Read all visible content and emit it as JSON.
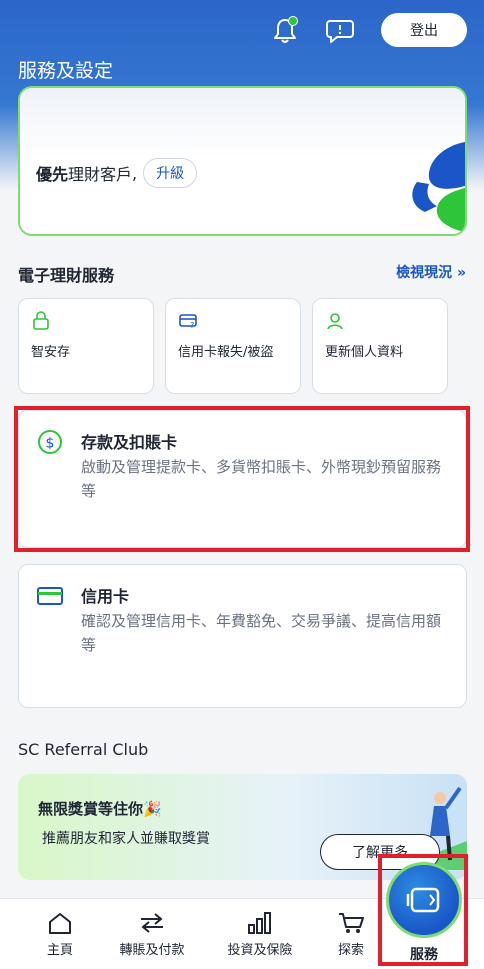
{
  "header": {
    "logout_label": "登出",
    "page_title": "服務及設定"
  },
  "profile": {
    "tier_bold": "優先",
    "tier_rest": "理財客戶",
    "separator": ",",
    "upgrade_label": "升級"
  },
  "ebanking": {
    "title": "電子理財服務",
    "view_link": "檢視現況 »",
    "tiles": [
      {
        "label": "智安存",
        "icon": "lock-icon"
      },
      {
        "label": "信用卡報失/被盜",
        "icon": "card-report-icon"
      },
      {
        "label": "更新個人資料",
        "icon": "person-icon"
      }
    ]
  },
  "features": {
    "deposit": {
      "title": "存款及扣賬卡",
      "desc": "啟動及管理提款卡、多貨幣扣賬卡、外幣現鈔預留服務等"
    },
    "credit": {
      "title": "信用卡",
      "desc": "確認及管理信用卡、年費豁免、交易爭議、提高信用額等"
    }
  },
  "referral": {
    "section_title": "SC Referral Club",
    "headline": "無限獎賞等住你",
    "sub": "推薦朋友和家人並賺取獎賞",
    "learn_more": "了解更多"
  },
  "nav": {
    "home": "主頁",
    "transfer": "轉賬及付款",
    "invest": "投資及保險",
    "explore": "探索",
    "services": "服務"
  },
  "colors": {
    "brand_blue": "#1a56c8",
    "brand_green": "#7fdc72",
    "highlight_red": "#e0202d"
  }
}
